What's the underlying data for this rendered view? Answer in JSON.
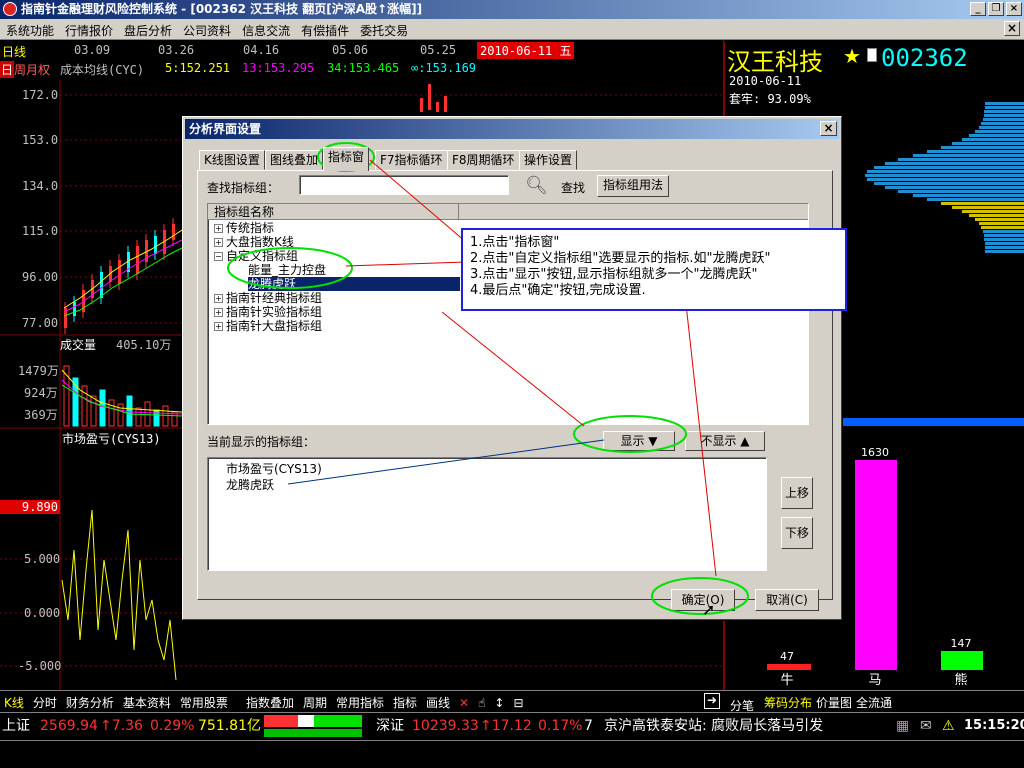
{
  "window": {
    "title": "指南针金融理财风险控制系统 - [002362 汉王科技 翻页[沪深A股↑涨幅]]",
    "buttons": [
      "_",
      "❐",
      "×"
    ]
  },
  "menu": {
    "items": [
      "系统功能",
      "行情报价",
      "盘后分析",
      "公司资料",
      "信息交流",
      "有偿插件",
      "委托交易"
    ],
    "close_label": "×"
  },
  "chart": {
    "period_label": "日线",
    "dates": [
      "03.09",
      "03.26",
      "04.16",
      "05.06",
      "05.25"
    ],
    "current_date": "2010-06-11 五",
    "period_tabs": [
      "日",
      "周",
      "月",
      "权"
    ],
    "ma_title": "成本均线(CYC)",
    "ma_values": [
      {
        "label": "5:152.251",
        "color": "#ffff00"
      },
      {
        "label": "13:153.295",
        "color": "#ff00ff"
      },
      {
        "label": "34:153.465",
        "color": "#00ff00"
      },
      {
        "label": "∞:153.169",
        "color": "#00ffff"
      }
    ],
    "price_ticks": [
      "172.0",
      "153.0",
      "134.0",
      "115.0",
      "96.00",
      "77.00"
    ],
    "volume_title": "成交量",
    "volume_value": "405.10万",
    "volume_ticks": [
      "1479万",
      "924万",
      "369万"
    ],
    "indicator_title": "市场盈亏(CYS13)",
    "indicator_current": "9.890",
    "indicator_ticks": [
      "5.000",
      "0.000",
      "-5.000"
    ]
  },
  "right_panel": {
    "stock_name": "汉王科技",
    "stock_code": "002362",
    "date": "2010-06-11",
    "lock_label": "套牢: 93.09%",
    "bars": [
      {
        "label": "牛",
        "value": "47",
        "color": "#ff2020",
        "fraction": 0.029
      },
      {
        "label": "马",
        "value": "1630",
        "color": "#ff00ff",
        "fraction": 1.0
      },
      {
        "label": "熊",
        "value": "147",
        "color": "#00ff00",
        "fraction": 0.09
      }
    ]
  },
  "dialog": {
    "title": "分析界面设置",
    "tabs": [
      "K线图设置",
      "图线叠加",
      "指标窗",
      "F7指标循环",
      "F8周期循环",
      "操作设置"
    ],
    "active_tab": 2,
    "search_label": "查找指标组：",
    "search_value": "",
    "search_button": "查找",
    "usage_button": "指标组用法",
    "tree_header": "指标组名称",
    "tree_items": [
      {
        "label": "传统指标",
        "level": 0,
        "expander": "+"
      },
      {
        "label": "大盘指数K线",
        "level": 0,
        "expander": "+"
      },
      {
        "label": "自定义指标组",
        "level": 0,
        "expander": "-"
      },
      {
        "label": "能量_主力控盘",
        "level": 1,
        "expander": ""
      },
      {
        "label": "龙腾虎跃",
        "level": 1,
        "expander": "",
        "selected": true
      },
      {
        "label": "指南针经典指标组",
        "level": 0,
        "expander": "+"
      },
      {
        "label": "指南针实验指标组",
        "level": 0,
        "expander": "+"
      },
      {
        "label": "指南针大盘指标组",
        "level": 0,
        "expander": "+"
      }
    ],
    "current_label": "当前显示的指标组：",
    "show_button": "显示 ▼",
    "hide_button": "不显示 ▲",
    "current_items": [
      "市场盈亏(CYS13)",
      "龙腾虎跃"
    ],
    "up_button": "上移",
    "down_button": "下移",
    "ok_button": "确定(O)",
    "cancel_button": "取消(C)"
  },
  "annotation": {
    "lines": [
      "1.点击\"指标窗\"",
      "2.点击\"自定义指标组\"选要显示的指标.如\"龙腾虎跃\"",
      "3.点击\"显示\"按钮,显示指标组就多一个\"龙腾虎跃\"",
      "4.最后点\"确定\"按钮,完成设置."
    ]
  },
  "bottom": {
    "left_tabs": [
      "K线",
      "分时",
      "财务分析",
      "基本资料",
      "常用股票"
    ],
    "tools": [
      "指数叠加",
      "周期",
      "常用指标",
      "指标",
      "画线"
    ],
    "right_tabs": [
      "分笔",
      "筹码分布",
      "价量图",
      "全流通"
    ]
  },
  "status": {
    "sh_label": "上证",
    "sh_index": "2569.94",
    "sh_change": "↑7.36",
    "sh_pct": "0.29%",
    "sh_amount": "751.81亿",
    "sz_label": "深证",
    "sz_index": "10239.33",
    "sz_change": "↑17.12",
    "sz_pct": "0.17%",
    "sz_num": "7",
    "ticker": "京沪高铁泰安站: 腐败局长落马引发",
    "time": "15:15:20"
  }
}
